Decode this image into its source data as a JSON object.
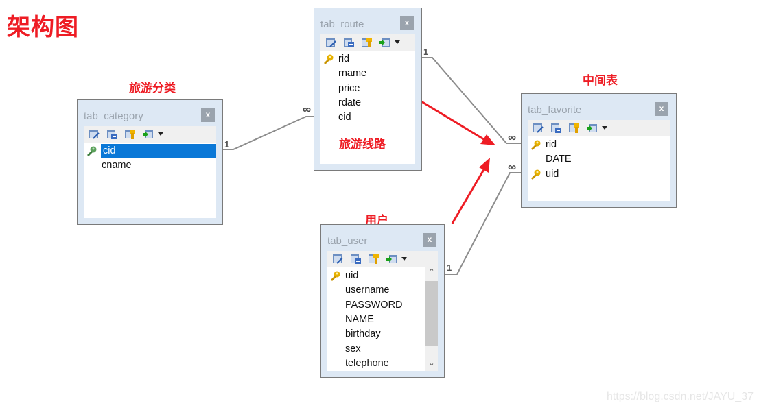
{
  "title": "架构图",
  "labels": {
    "category": "旅游分类",
    "route": "旅游线路",
    "favorite": "中间表",
    "user": "用户"
  },
  "colors": {
    "annotation": "#ee1c24",
    "selection": "#0a78d7",
    "relation_line": "#8c8c8c"
  },
  "tables": {
    "category": {
      "name": "tab_category",
      "close": "x",
      "columns": [
        {
          "name": "cid",
          "key": "primary",
          "selected": true
        },
        {
          "name": "cname",
          "key": "none"
        }
      ]
    },
    "route": {
      "name": "tab_route",
      "close": "x",
      "columns": [
        {
          "name": "rid",
          "key": "primary"
        },
        {
          "name": "rname",
          "key": "none"
        },
        {
          "name": "price",
          "key": "none"
        },
        {
          "name": "rdate",
          "key": "none"
        },
        {
          "name": "cid",
          "key": "none"
        }
      ]
    },
    "favorite": {
      "name": "tab_favorite",
      "close": "x",
      "columns": [
        {
          "name": "rid",
          "key": "primary"
        },
        {
          "name": "DATE",
          "key": "none"
        },
        {
          "name": "uid",
          "key": "primary"
        }
      ]
    },
    "user": {
      "name": "tab_user",
      "close": "x",
      "columns": [
        {
          "name": "uid",
          "key": "primary"
        },
        {
          "name": "username",
          "key": "none"
        },
        {
          "name": "PASSWORD",
          "key": "none"
        },
        {
          "name": "NAME",
          "key": "none"
        },
        {
          "name": "birthday",
          "key": "none"
        },
        {
          "name": "sex",
          "key": "none"
        },
        {
          "name": "telephone",
          "key": "none"
        }
      ],
      "scroll_up": "^",
      "scroll_down": "v"
    }
  },
  "toolbar_icons": [
    "table-design-icon",
    "table-properties-icon",
    "primary-key-icon",
    "import-icon"
  ],
  "relations": [
    {
      "from": "tab_category.cid",
      "to": "tab_route.cid",
      "from_cardinality": "1",
      "to_cardinality": "∞"
    },
    {
      "from": "tab_route.rid",
      "to": "tab_favorite.rid",
      "from_cardinality": "1",
      "to_cardinality": "∞"
    },
    {
      "from": "tab_user.uid",
      "to": "tab_favorite.uid",
      "from_cardinality": "1",
      "to_cardinality": "∞"
    }
  ],
  "watermark": "https://blog.csdn.net/JAYU_37"
}
